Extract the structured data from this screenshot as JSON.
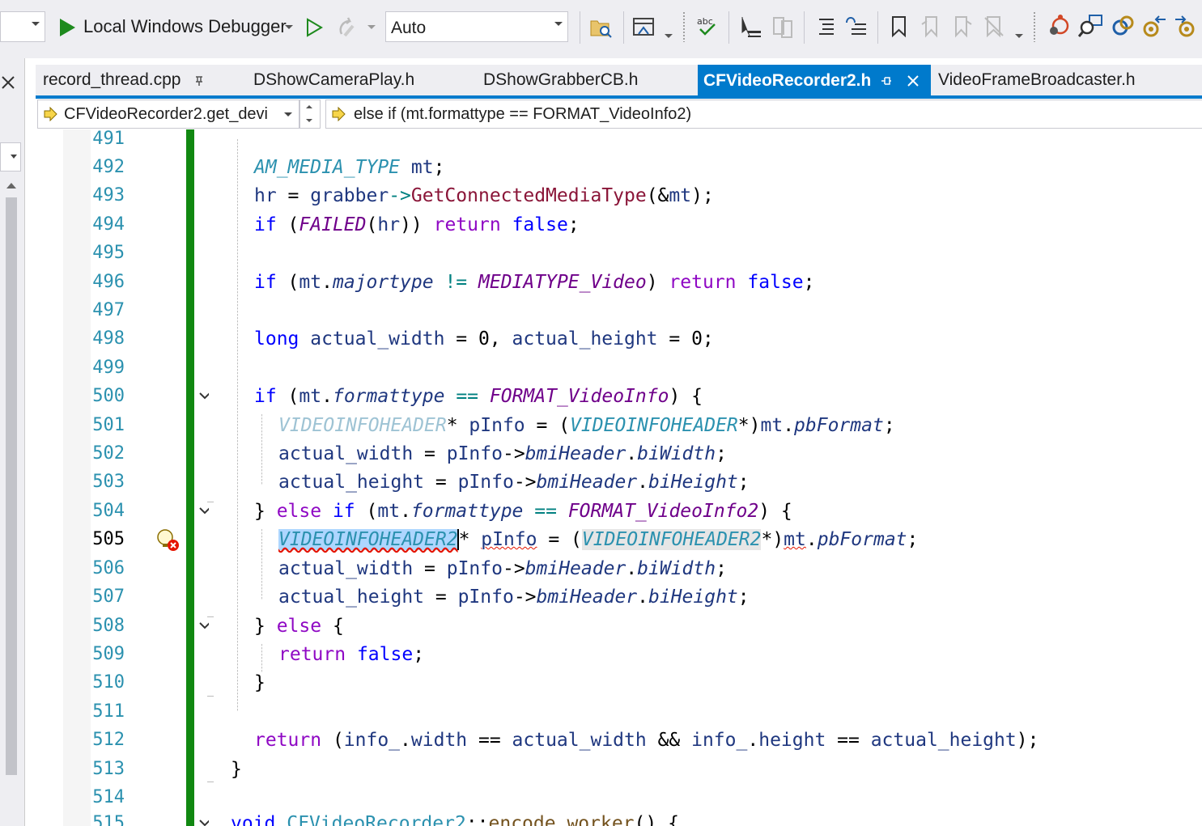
{
  "toolbar": {
    "config_dropdown_value": "",
    "debugger_label": "Local Windows Debugger",
    "auto_dropdown_value": "Auto"
  },
  "tabs": [
    {
      "label": "record_thread.cpp",
      "pinned": true,
      "active": false
    },
    {
      "label": "DShowCameraPlay.h",
      "active": false
    },
    {
      "label": "DShowGrabberCB.h",
      "active": false
    },
    {
      "label": "CFVideoRecorder2.h",
      "pinned": true,
      "active": true
    },
    {
      "label": "VideoFrameBroadcaster.h",
      "active": false
    }
  ],
  "navbar": {
    "scope": "CFVideoRecorder2.get_devi",
    "member": "else if (mt.formattype == FORMAT_VideoInfo2)"
  },
  "editor": {
    "current_line": "505",
    "line_numbers": [
      "491",
      "492",
      "493",
      "494",
      "495",
      "496",
      "497",
      "498",
      "499",
      "500",
      "501",
      "502",
      "503",
      "504",
      "505",
      "506",
      "507",
      "508",
      "509",
      "510",
      "511",
      "512",
      "513",
      "514",
      "515"
    ]
  },
  "colors": {
    "accent": "#007acc",
    "change_bar": "#118811",
    "keyword": "#0000ff",
    "control": "#8f08c4",
    "type": "#2b91af",
    "error": "#e51400"
  }
}
